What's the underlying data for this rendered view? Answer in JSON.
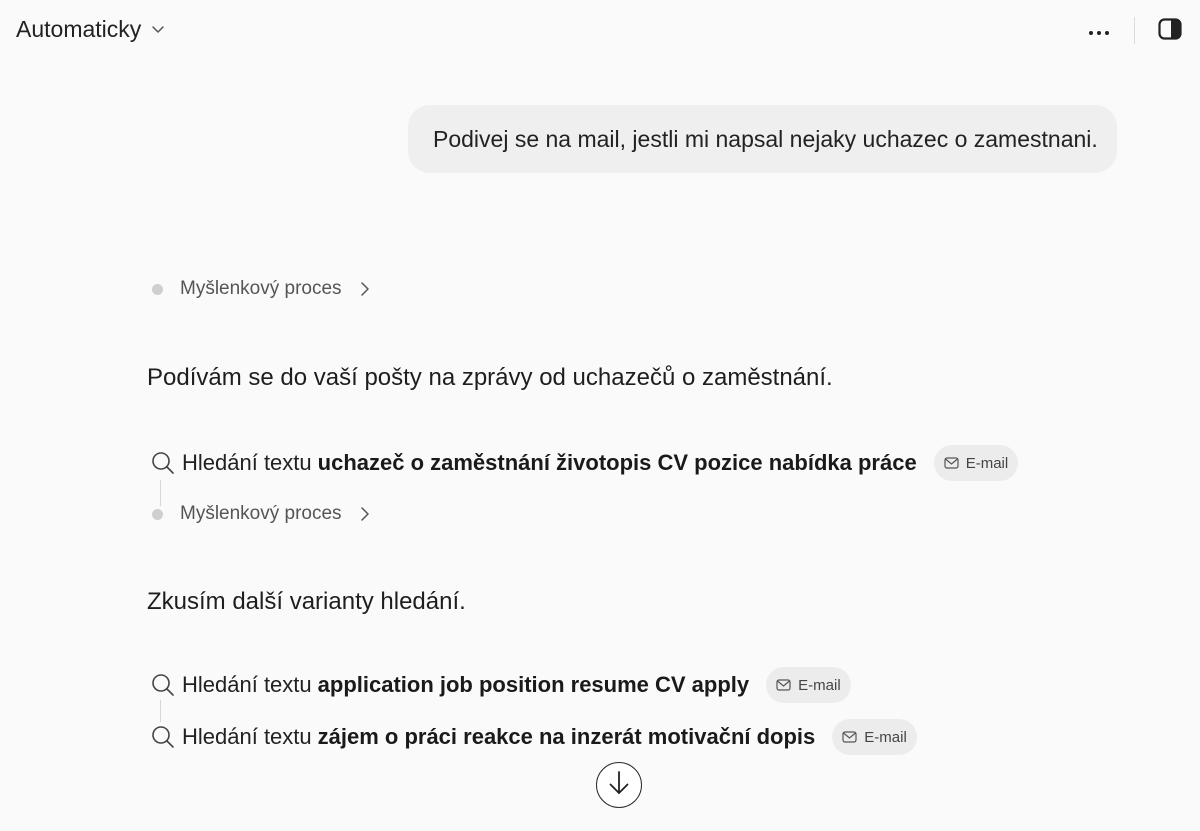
{
  "header": {
    "mode_label": "Automaticky",
    "mode_icon": "chevron-down-icon",
    "more_icon": "ellipsis-icon",
    "panel_icon": "sidebar-panel-icon"
  },
  "conversation": {
    "user_message": "Podivej se na mail, jestli mi napsal nejaky uchazec o zamestnani.",
    "thought_label_1": "Myšlenkový proces",
    "assistant_text_1": "Podívám se do vaší pošty na zprávy od uchazečů o zaměstnání.",
    "search_1": {
      "prefix": "Hledání textu",
      "query": "uchazeč o zaměstnání životopis CV pozice nabídka práce",
      "chip": "E-mail"
    },
    "thought_label_2": "Myšlenkový proces",
    "assistant_text_2": "Zkusím další varianty hledání.",
    "search_2": {
      "prefix": "Hledání textu",
      "query": "application job position resume CV apply",
      "chip": "E-mail"
    },
    "search_3": {
      "prefix": "Hledání textu",
      "query": "zájem o práci reakce na inzerát motivační dopis",
      "chip": "E-mail"
    }
  },
  "colors": {
    "background": "#fafafa",
    "bubble": "#efefef",
    "chip": "#ececec"
  }
}
